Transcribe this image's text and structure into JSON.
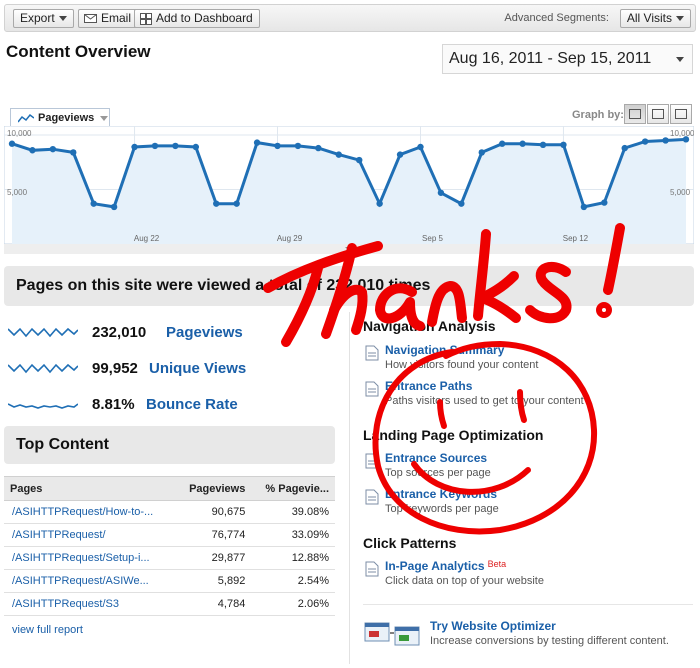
{
  "toolbar": {
    "export_label": "Export",
    "email_label": "Email",
    "dashboard_label": "Add to Dashboard",
    "segments_label": "Advanced Segments:",
    "segments_value": "All Visits"
  },
  "header": {
    "title": "Content Overview",
    "date_range": "Aug 16, 2011 - Sep 15, 2011"
  },
  "graph": {
    "metric_label": "Pageviews",
    "graph_by_label": "Graph by:",
    "y_labels": [
      "10,000",
      "5,000"
    ],
    "x_labels": [
      "Aug 22",
      "Aug 29",
      "Sep 5",
      "Sep 12"
    ],
    "chart_data": {
      "type": "line",
      "series": [
        {
          "name": "Pageviews",
          "values": [
            9200,
            8600,
            8700,
            8400,
            3700,
            3400,
            8900,
            9000,
            9000,
            8900,
            3700,
            3700,
            9300,
            9000,
            9000,
            8800,
            8200,
            7700,
            3700,
            8200,
            8900,
            4700,
            3700,
            8400,
            9200,
            9200,
            9100,
            9100,
            3400,
            3800,
            8800,
            9400,
            9500,
            9600
          ]
        }
      ],
      "ylim": [
        0,
        10000
      ],
      "line_color": "#1f6fb5",
      "fill_color": "#e6f1fa"
    }
  },
  "summary": {
    "headline": "Pages on this site were viewed a total of 232,010 times",
    "metrics": [
      {
        "value": "232,010",
        "label": "Pageviews"
      },
      {
        "value": "99,952",
        "label": "Unique Views"
      },
      {
        "value": "8.81%",
        "label": "Bounce Rate"
      }
    ]
  },
  "top_content": {
    "title": "Top Content",
    "columns": [
      "Pages",
      "Pageviews",
      "% Pagevie..."
    ],
    "rows": [
      {
        "page": "/ASIHTTPRequest/How-to-...",
        "pageviews": "90,675",
        "pct": "39.08%"
      },
      {
        "page": "/ASIHTTPRequest/",
        "pageviews": "76,774",
        "pct": "33.09%"
      },
      {
        "page": "/ASIHTTPRequest/Setup-i...",
        "pageviews": "29,877",
        "pct": "12.88%"
      },
      {
        "page": "/ASIHTTPRequest/ASIWe...",
        "pageviews": "5,892",
        "pct": "2.54%"
      },
      {
        "page": "/ASIHTTPRequest/S3",
        "pageviews": "4,784",
        "pct": "2.06%"
      }
    ],
    "full_report_label": "view full report"
  },
  "navigation": {
    "title": "Navigation Analysis",
    "items": [
      {
        "title": "Navigation Summary",
        "desc": "How visitors found your content"
      },
      {
        "title": "Entrance Paths",
        "desc": "Paths visitors used to get to your content"
      }
    ]
  },
  "landing": {
    "title": "Landing Page Optimization",
    "items": [
      {
        "title": "Entrance Sources",
        "desc": "Top sources per page"
      },
      {
        "title": "Entrance Keywords",
        "desc": "Top keywords per page"
      }
    ]
  },
  "click": {
    "title": "Click Patterns",
    "item_title": "In-Page Analytics",
    "beta": "Beta",
    "item_desc": "Click data on top of your website"
  },
  "optimizer": {
    "title": "Try Website Optimizer",
    "desc": "Increase conversions by testing different content."
  },
  "annotation": {
    "handwriting": "Thanks!",
    "ink_color": "#ee0000"
  }
}
